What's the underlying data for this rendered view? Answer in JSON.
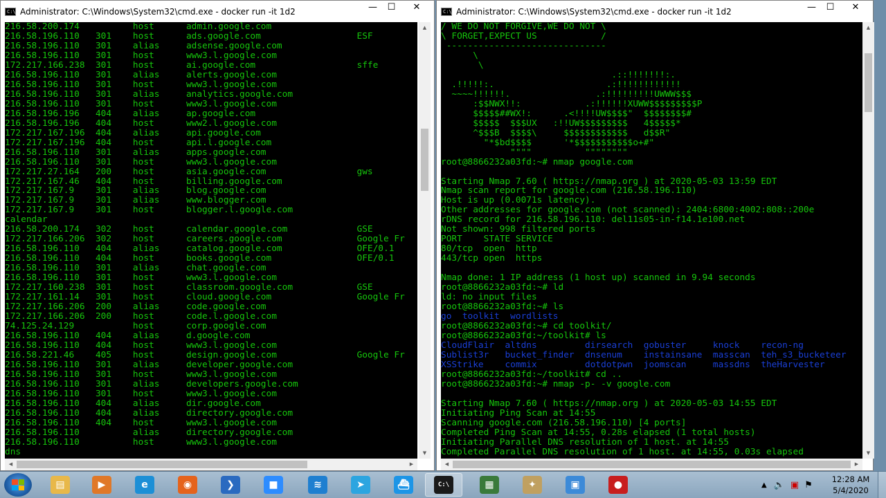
{
  "left_window": {
    "title": "Administrator: C:\\Windows\\System32\\cmd.exe - docker  run -it 1d2",
    "lines": [
      "216.58.200.174          host      admin.google.com",
      "216.58.196.110   301    host      ads.google.com                  ESF",
      "216.58.196.110   301    alias     adsense.google.com",
      "216.58.196.110   301    host      www3.l.google.com",
      "172.217.166.238  301    host      ai.google.com                   sffe",
      "216.58.196.110   301    alias     alerts.google.com",
      "216.58.196.110   301    host      www3.l.google.com",
      "216.58.196.110   301    alias     analytics.google.com",
      "216.58.196.110   301    host      www3.l.google.com",
      "216.58.196.196   404    alias     ap.google.com",
      "216.58.196.196   404    host      www2.l.google.com",
      "172.217.167.196  404    alias     api.google.com",
      "172.217.167.196  404    host      api.l.google.com",
      "216.58.196.110   301    alias     apps.google.com",
      "216.58.196.110   301    host      www3.l.google.com",
      "172.217.27.164   200    host      asia.google.com                 gws",
      "172.217.167.46   404    host      billing.google.com",
      "172.217.167.9    301    alias     blog.google.com",
      "172.217.167.9    301    alias     www.blogger.com",
      "172.217.167.9    301    host      blogger.l.google.com",
      "calendar",
      "216.58.200.174   302    host      calendar.google.com             GSE",
      "172.217.166.206  302    host      careers.google.com              Google Fr",
      "216.58.196.110   404    alias     catalog.google.com              OFE/0.1",
      "216.58.196.110   404    host      books.google.com                OFE/0.1",
      "216.58.196.110   301    alias     chat.google.com",
      "216.58.196.110   301    host      www3.l.google.com",
      "172.217.160.238  301    host      classroom.google.com            GSE",
      "172.217.161.14   301    host      cloud.google.com                Google Fr",
      "172.217.166.206  200    alias     code.google.com",
      "172.217.166.206  200    host      code.l.google.com",
      "74.125.24.129           host      corp.google.com",
      "216.58.196.110   404    alias     d.google.com",
      "216.58.196.110   404    host      www3.l.google.com",
      "216.58.221.46    405    host      design.google.com               Google Fr",
      "216.58.196.110   301    alias     developer.google.com",
      "216.58.196.110   301    host      www3.l.google.com",
      "216.58.196.110   301    alias     developers.google.com",
      "216.58.196.110   301    host      www3.l.google.com",
      "216.58.196.110   404    alias     dir.google.com",
      "216.58.196.110   404    alias     directory.google.com",
      "216.58.196.110   404    host      www3.l.google.com",
      "216.58.196.110          alias     directory.google.com",
      "216.58.196.110          host      www3.l.google.com",
      "dns"
    ]
  },
  "right_window": {
    "title": "Administrator: C:\\Windows\\System32\\cmd.exe - docker  run -it 1d2",
    "lines": [
      {
        "t": "/ WE DO NOT FORGIVE,WE DO NOT \\",
        "c": "green"
      },
      {
        "t": "\\ FORGET,EXPECT US            /",
        "c": "green"
      },
      {
        "t": " ------------------------------",
        "c": "green"
      },
      {
        "t": "      \\",
        "c": "green"
      },
      {
        "t": "       \\",
        "c": "green"
      },
      {
        "t": "                                .::!!!!!!!:.",
        "c": "green"
      },
      {
        "t": "  .!!!!!:.                     .:!!!!!!!!!!!!",
        "c": "green"
      },
      {
        "t": "  ~~~~!!!!!!.                .:!!!!!!!!!UWWW$$$",
        "c": "green"
      },
      {
        "t": "      :$$NWX!!:            .:!!!!!!XUWW$$$$$$$$$P",
        "c": "green"
      },
      {
        "t": "      $$$$$##WX!:      .<!!!!UW$$$$\"  $$$$$$$$#",
        "c": "green"
      },
      {
        "t": "      $$$$$  $$$UX   :!!UW$$$$$$$$$   4$$$$$*",
        "c": "green"
      },
      {
        "t": "      ^$$$B  $$$$\\     $$$$$$$$$$$$   d$$R\"",
        "c": "green"
      },
      {
        "t": "        \"*$bd$$$$      '*$$$$$$$$$$$o+#\"",
        "c": "green"
      },
      {
        "t": "             \"\"\"\"          \"\"\"\"\"\"\"\"",
        "c": "green"
      },
      {
        "t": "root@8866232a03fd:~# nmap google.com",
        "c": "green"
      },
      {
        "t": "",
        "c": "green"
      },
      {
        "t": "Starting Nmap 7.60 ( https://nmap.org ) at 2020-05-03 13:59 EDT",
        "c": "green"
      },
      {
        "t": "Nmap scan report for google.com (216.58.196.110)",
        "c": "green"
      },
      {
        "t": "Host is up (0.0071s latency).",
        "c": "green"
      },
      {
        "t": "Other addresses for google.com (not scanned): 2404:6800:4002:808::200e",
        "c": "green"
      },
      {
        "t": "rDNS record for 216.58.196.110: del11s05-in-f14.1e100.net",
        "c": "green"
      },
      {
        "t": "Not shown: 998 filtered ports",
        "c": "green"
      },
      {
        "t": "PORT    STATE SERVICE",
        "c": "green"
      },
      {
        "t": "80/tcp  open  http",
        "c": "green"
      },
      {
        "t": "443/tcp open  https",
        "c": "green"
      },
      {
        "t": "",
        "c": "green"
      },
      {
        "t": "Nmap done: 1 IP address (1 host up) scanned in 9.94 seconds",
        "c": "green"
      },
      {
        "t": "root@8866232a03fd:~# ld",
        "c": "green"
      },
      {
        "t": "ld: no input files",
        "c": "green"
      },
      {
        "t": "root@8866232a03fd:~# ls",
        "c": "green"
      },
      {
        "t": "go  toolkit  wordlists",
        "c": "blue"
      },
      {
        "t": "root@8866232a03fd:~# cd toolkit/",
        "c": "green"
      },
      {
        "t": "root@8866232a03fd:~/toolkit# ls",
        "c": "green"
      },
      {
        "t": "CloudFlair  altdns         dirsearch  gobuster     knock    recon-ng",
        "c": "blue"
      },
      {
        "t": "Sublist3r   bucket_finder  dnsenum    instainsane  masscan  teh_s3_bucketeer",
        "c": "blue"
      },
      {
        "t": "XSStrike    commix         dotdotpwn  joomscan     massdns  theHarvester",
        "c": "blue"
      },
      {
        "t": "root@8866232a03fd:~/toolkit# cd ..",
        "c": "green"
      },
      {
        "t": "root@8866232a03fd:~# nmap -p- -v google.com",
        "c": "green"
      },
      {
        "t": "",
        "c": "green"
      },
      {
        "t": "Starting Nmap 7.60 ( https://nmap.org ) at 2020-05-03 14:55 EDT",
        "c": "green"
      },
      {
        "t": "Initiating Ping Scan at 14:55",
        "c": "green"
      },
      {
        "t": "Scanning google.com (216.58.196.110) [4 ports]",
        "c": "green"
      },
      {
        "t": "Completed Ping Scan at 14:55, 0.28s elapsed (1 total hosts)",
        "c": "green"
      },
      {
        "t": "Initiating Parallel DNS resolution of 1 host. at 14:55",
        "c": "green"
      },
      {
        "t": "Completed Parallel DNS resolution of 1 host. at 14:55, 0.03s elapsed",
        "c": "green"
      }
    ]
  },
  "window_buttons": {
    "minimize": "—",
    "maximize": "☐",
    "close": "✕"
  },
  "colors": {
    "console_green": "#16c60c",
    "console_blue": "#1a3fd6",
    "console_bg": "#000000"
  },
  "taskbar": {
    "pinned": [
      {
        "name": "file-explorer",
        "glyph": "▤",
        "color": "#e8b84a"
      },
      {
        "name": "media-player",
        "glyph": "▶",
        "color": "#e07828"
      },
      {
        "name": "edge",
        "glyph": "e",
        "color": "#1c8fd6"
      },
      {
        "name": "firefox",
        "glyph": "◉",
        "color": "#e5631c"
      },
      {
        "name": "powershell",
        "glyph": "❯",
        "color": "#2a6ac0"
      },
      {
        "name": "zoom",
        "glyph": "■",
        "color": "#2d8cff"
      },
      {
        "name": "wifi-app",
        "glyph": "≋",
        "color": "#1f7fd0"
      },
      {
        "name": "telegram",
        "glyph": "➤",
        "color": "#2ca5e0"
      },
      {
        "name": "docker",
        "glyph": "⛴",
        "color": "#1d95e6"
      },
      {
        "name": "cmd",
        "glyph": "C:\\",
        "color": "#1a1a1a"
      },
      {
        "name": "task-manager",
        "glyph": "▦",
        "color": "#3a7a3a"
      },
      {
        "name": "tool-app",
        "glyph": "✦",
        "color": "#c0a060"
      },
      {
        "name": "remote-desktop",
        "glyph": "▣",
        "color": "#3c8ad8"
      },
      {
        "name": "screen-recorder",
        "glyph": "●",
        "color": "#c81e1e"
      }
    ],
    "clock_time": "12:28 AM",
    "clock_date": "5/4/2020"
  }
}
